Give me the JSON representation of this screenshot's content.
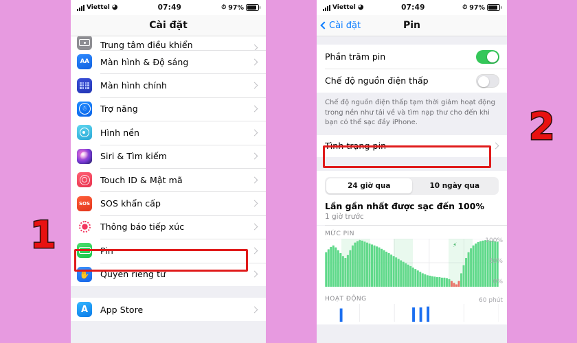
{
  "background_color": "#e79ae0",
  "accent_red": "#e01b1b",
  "status_bar": {
    "carrier": "Viettel",
    "time": "07:49",
    "battery_percent": "97%",
    "wifi_icon": "wifi-icon",
    "signal_icon": "cellular-signal-icon",
    "alarm_icon": "alarm-icon",
    "battery_icon": "battery-icon"
  },
  "left_phone": {
    "nav_title": "Cài đặt",
    "groups": [
      {
        "items": [
          {
            "label": "Trung tâm điều khiển",
            "icon": "control-center-icon",
            "icon_class": "i-control",
            "partial": true
          },
          {
            "label": "Màn hình & Độ sáng",
            "icon": "display-brightness-icon",
            "icon_class": "i-display",
            "glyph": "AA"
          },
          {
            "label": "Màn hình chính",
            "icon": "home-screen-icon",
            "icon_class": "i-home"
          },
          {
            "label": "Trợ năng",
            "icon": "accessibility-icon",
            "icon_class": "i-access"
          },
          {
            "label": "Hình nền",
            "icon": "wallpaper-icon",
            "icon_class": "i-wall"
          },
          {
            "label": "Siri & Tìm kiếm",
            "icon": "siri-search-icon",
            "icon_class": "i-siri"
          },
          {
            "label": "Touch ID & Mật mã",
            "icon": "touch-id-icon",
            "icon_class": "i-touch"
          },
          {
            "label": "SOS khẩn cấp",
            "icon": "sos-icon",
            "icon_class": "i-sos",
            "glyph": "SOS"
          },
          {
            "label": "Thông báo tiếp xúc",
            "icon": "exposure-notification-icon",
            "icon_class": "i-expo"
          },
          {
            "label": "Pin",
            "icon": "battery-settings-icon",
            "icon_class": "i-battery",
            "highlighted": true
          },
          {
            "label": "Quyền riêng tư",
            "icon": "privacy-icon",
            "icon_class": "i-privacy"
          }
        ]
      },
      {
        "items": [
          {
            "label": "App Store",
            "icon": "app-store-icon",
            "icon_class": "i-appstore",
            "glyph": "A"
          }
        ]
      }
    ]
  },
  "right_phone": {
    "nav_back_label": "Cài đặt",
    "nav_title": "Pin",
    "toggles": [
      {
        "label": "Phần trăm pin",
        "state": "on"
      },
      {
        "label": "Chế độ nguồn điện thấp",
        "state": "off"
      }
    ],
    "footnote": "Chế độ nguồn điện thấp tạm thời giảm hoạt động trong nền như tải về và tìm nạp thư cho đến khi bạn có thể sạc đầy iPhone.",
    "battery_health_row": "Tình trạng pin",
    "segmented": {
      "options": [
        "24 giờ qua",
        "10 ngày qua"
      ],
      "selected": "24 giờ qua"
    },
    "last_charge_title": "Lần gần nhất được sạc đến 100%",
    "last_charge_sub": "1 giờ trước",
    "battery_level_header": "MỨC PIN",
    "activity_header": "HOẠT ĐỘNG",
    "y_labels": [
      "100%",
      "50%",
      "0%"
    ],
    "activity_y_label": "60 phút"
  },
  "annotations": [
    {
      "id": "1",
      "label": "1"
    },
    {
      "id": "2",
      "label": "2"
    }
  ],
  "chart_data": [
    {
      "type": "bar",
      "title": "MỨC PIN",
      "xlabel": "",
      "ylabel": "",
      "ylim": [
        0,
        100
      ],
      "y_ticks": [
        0,
        50,
        100
      ],
      "y_tick_labels": [
        "0%",
        "50%",
        "100%"
      ],
      "grid": true,
      "legend": "none",
      "bar_color": "#5fd98a",
      "charging_color": "#ff5f5f",
      "values": [
        72,
        78,
        83,
        86,
        82,
        76,
        70,
        64,
        60,
        66,
        76,
        86,
        92,
        95,
        97,
        96,
        94,
        92,
        90,
        88,
        86,
        84,
        82,
        79,
        76,
        73,
        70,
        67,
        64,
        61,
        58,
        55,
        52,
        49,
        46,
        43,
        40,
        37,
        34,
        31,
        28,
        26,
        24,
        23,
        22,
        21,
        20,
        20,
        19,
        19,
        18,
        16,
        12,
        8,
        5,
        12,
        28,
        45,
        60,
        72,
        80,
        86,
        90,
        93,
        95,
        96,
        97,
        97,
        96,
        96,
        95,
        94
      ],
      "charging_indices": [
        52,
        53,
        54,
        55
      ],
      "charge_bolt_marker": true
    },
    {
      "type": "bar",
      "title": "HOẠT ĐỘNG",
      "xlabel": "",
      "ylabel": "",
      "ylim": [
        0,
        60
      ],
      "y_tick_labels": [
        "60 phút"
      ],
      "grid": true,
      "bar_color": "#1c6ff0",
      "values": [
        0,
        0,
        0,
        0,
        28,
        0,
        0,
        0,
        0,
        0,
        0,
        0,
        0,
        0,
        0,
        0,
        0,
        0,
        0,
        0,
        0,
        0,
        0,
        0,
        30,
        0,
        30,
        0,
        32,
        0,
        0,
        0,
        0,
        0,
        0,
        0,
        0,
        0,
        0,
        0,
        0,
        0,
        0,
        0,
        0,
        0,
        0,
        0
      ]
    }
  ]
}
